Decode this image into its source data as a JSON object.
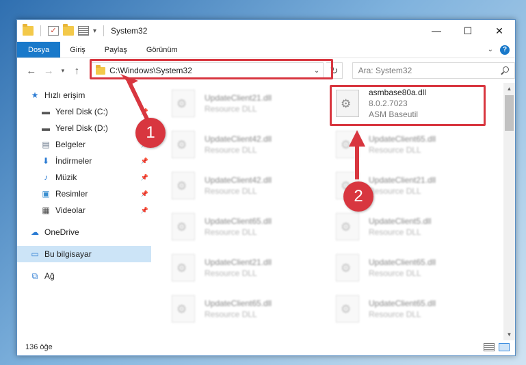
{
  "window": {
    "title": "System32",
    "controls": {
      "minimize": "—",
      "maximize": "☐",
      "close": "✕"
    }
  },
  "ribbon": {
    "tabs": [
      "Dosya",
      "Giriş",
      "Paylaş",
      "Görünüm"
    ],
    "help": "?",
    "expand": "⌄"
  },
  "address": {
    "path": "C:\\Windows\\System32",
    "search_placeholder": "Ara: System32"
  },
  "sidebar": {
    "items": [
      {
        "label": "Hızlı erişim",
        "icon": "star-icon"
      },
      {
        "label": "Yerel Disk (C:)",
        "icon": "drive-icon"
      },
      {
        "label": "Yerel Disk (D:)",
        "icon": "drive-icon"
      },
      {
        "label": "Belgeler",
        "icon": "documents-icon"
      },
      {
        "label": "İndirmeler",
        "icon": "download-icon"
      },
      {
        "label": "Müzik",
        "icon": "music-icon"
      },
      {
        "label": "Resimler",
        "icon": "pictures-icon"
      },
      {
        "label": "Videolar",
        "icon": "video-icon"
      },
      {
        "label": "OneDrive",
        "icon": "cloud-icon"
      },
      {
        "label": "Bu bilgisayar",
        "icon": "computer-icon"
      },
      {
        "label": "Ağ",
        "icon": "network-icon"
      }
    ]
  },
  "files": {
    "left": [
      {
        "name": "UpdateClient21.dll",
        "desc": "Resource DLL"
      },
      {
        "name": "UpdateClient42.dll",
        "desc": "Resource DLL"
      },
      {
        "name": "UpdateClient42.dll",
        "desc": "Resource DLL"
      },
      {
        "name": "UpdateClient65.dll",
        "desc": "Resource DLL"
      },
      {
        "name": "UpdateClient21.dll",
        "desc": "Resource DLL"
      },
      {
        "name": "UpdateClient65.dll",
        "desc": "Resource DLL"
      }
    ],
    "right": [
      {
        "name": "asmbase80a.dll",
        "version": "8.0.2.7023",
        "desc": "ASM Baseutil"
      },
      {
        "name": "UpdateClient65.dll",
        "desc": "Resource DLL"
      },
      {
        "name": "UpdateClient21.dll",
        "desc": "Resource DLL"
      },
      {
        "name": "UpdateClient5.dll",
        "desc": "Resource DLL"
      },
      {
        "name": "UpdateClient65.dll",
        "desc": "Resource DLL"
      },
      {
        "name": "UpdateClient65.dll",
        "desc": "Resource DLL"
      }
    ]
  },
  "status": {
    "count": "136 öğe"
  },
  "annotations": {
    "step1": "1",
    "step2": "2",
    "accent": "#d8363f"
  }
}
